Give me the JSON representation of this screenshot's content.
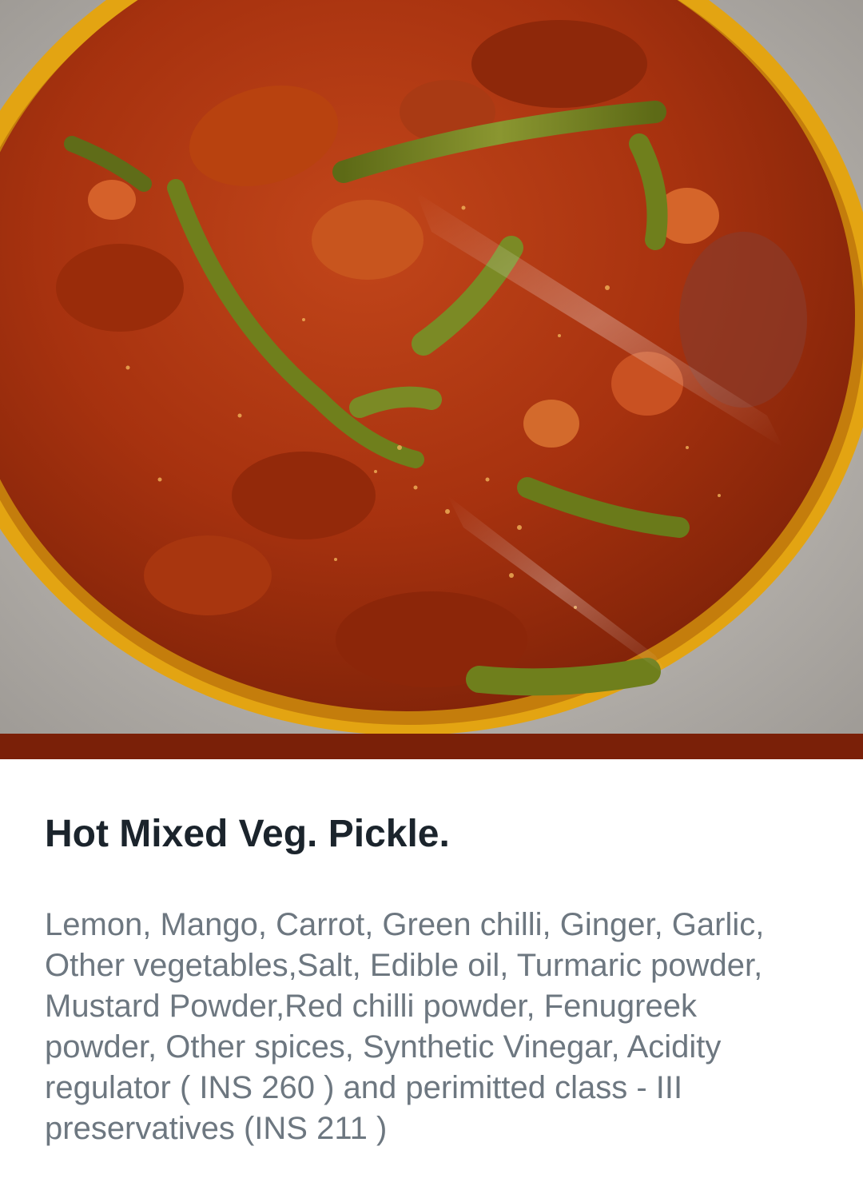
{
  "product": {
    "title": "Hot Mixed Veg. Pickle.",
    "ingredients": "Lemon, Mango, Carrot, Green chilli, Ginger, Garlic,\nOther vegetables,Salt, Edible oil, Turmaric powder,\nMustard Powder,Red chilli powder, Fenugreek\npowder, Other spices, Synthetic Vinegar, Acidity\nregulator ( INS 260 )  and perimitted class - III\npreservatives (INS 211 )"
  },
  "colors": {
    "accent_bar": "#7a2008",
    "title_text": "#1b242c",
    "body_text": "#6d7780",
    "pickle_red": "#a8300e",
    "bowl_yellow": "#e3a412",
    "chilli_green": "#6f7f1c"
  }
}
